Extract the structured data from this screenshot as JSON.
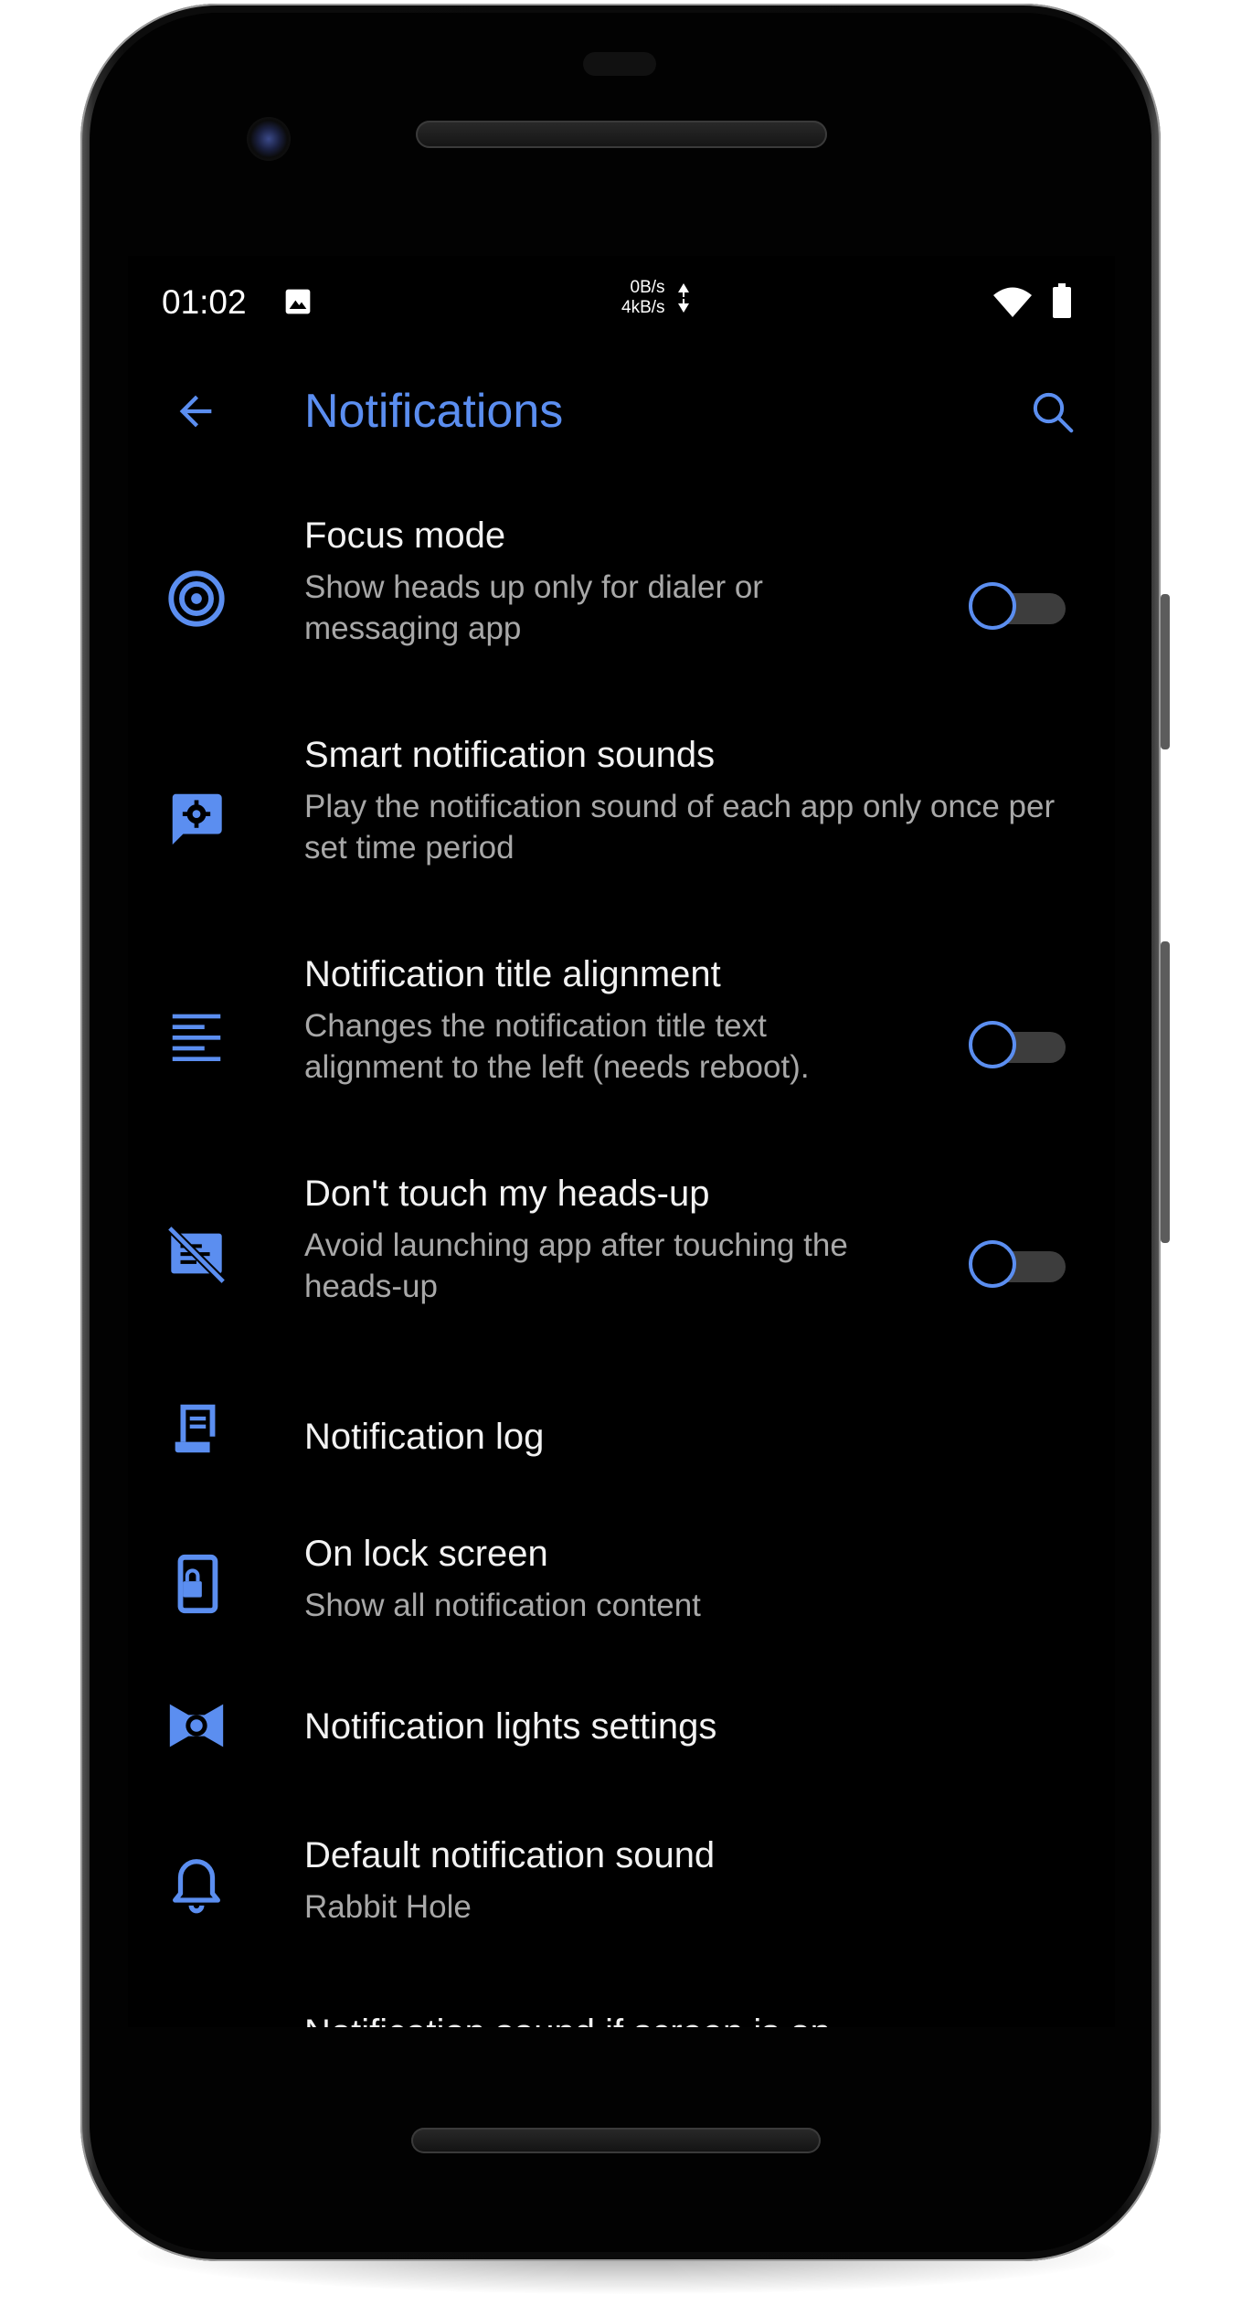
{
  "status_bar": {
    "time": "01:02",
    "net_up": "0B/s",
    "net_down": "4kB/s",
    "icons": [
      "image-icon",
      "network-arrows-icon",
      "wifi-icon",
      "battery-icon"
    ]
  },
  "toolbar": {
    "title": "Notifications",
    "back_icon": "arrow-left-icon",
    "search_icon": "search-icon"
  },
  "settings": [
    {
      "title": "Focus mode",
      "subtitle": "Show heads up only for dialer or messaging app",
      "icon": "target-icon",
      "toggle": false
    },
    {
      "title": "Smart notification sounds",
      "subtitle": "Play the notification sound of each app only once per set time period",
      "icon": "message-settings-icon"
    },
    {
      "title": "Notification title alignment",
      "subtitle": "Changes the notification title text alignment to the left (needs reboot).",
      "icon": "align-left-icon",
      "toggle": false
    },
    {
      "title": "Don't touch my heads-up",
      "subtitle": "Avoid launching app after touching the heads-up",
      "icon": "no-touch-icon",
      "toggle": false
    },
    {
      "title": "Notification log",
      "icon": "log-icon"
    },
    {
      "title": "On lock screen",
      "subtitle": "Show all notification content",
      "icon": "phone-lock-icon"
    },
    {
      "title": "Notification lights settings",
      "icon": "lights-icon"
    },
    {
      "title": "Default notification sound",
      "subtitle": "Rabbit Hole",
      "icon": "bell-icon"
    },
    {
      "title": "Notification sound if screen is on"
    }
  ],
  "colors": {
    "accent": "#5b8ef0",
    "background": "#000000",
    "title_text": "#f2f2f2",
    "subtitle_text": "#a8a8a8",
    "toggle_track": "#3d3d3d"
  }
}
